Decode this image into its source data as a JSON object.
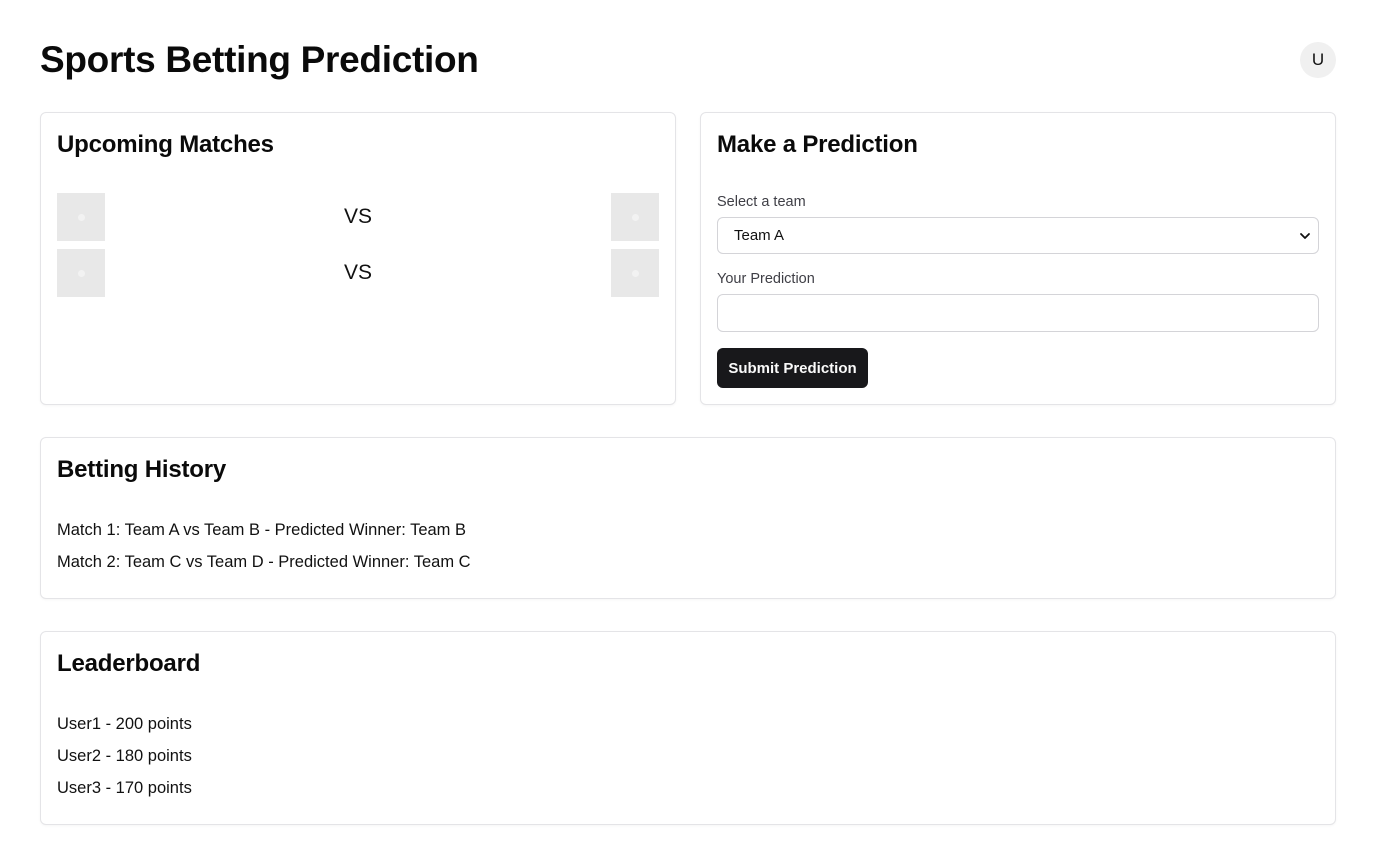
{
  "header": {
    "title": "Sports Betting Prediction",
    "avatar_initial": "U"
  },
  "upcoming_matches": {
    "title": "Upcoming Matches",
    "matches": [
      {
        "vs_label": "VS"
      },
      {
        "vs_label": "VS"
      }
    ]
  },
  "prediction": {
    "title": "Make a Prediction",
    "team_label": "Select a team",
    "team_selected": "Team A",
    "prediction_label": "Your Prediction",
    "prediction_value": "",
    "submit_label": "Submit Prediction"
  },
  "history": {
    "title": "Betting History",
    "items": [
      "Match 1: Team A vs Team B - Predicted Winner: Team B",
      "Match 2: Team C vs Team D - Predicted Winner: Team C"
    ]
  },
  "leaderboard": {
    "title": "Leaderboard",
    "items": [
      "User1 - 200 points",
      "User2 - 180 points",
      "User3 - 170 points"
    ]
  },
  "colors": {
    "primary_button": "#18181b",
    "card_border": "#e4e4e7",
    "placeholder_logo": "#e8e8e8"
  }
}
